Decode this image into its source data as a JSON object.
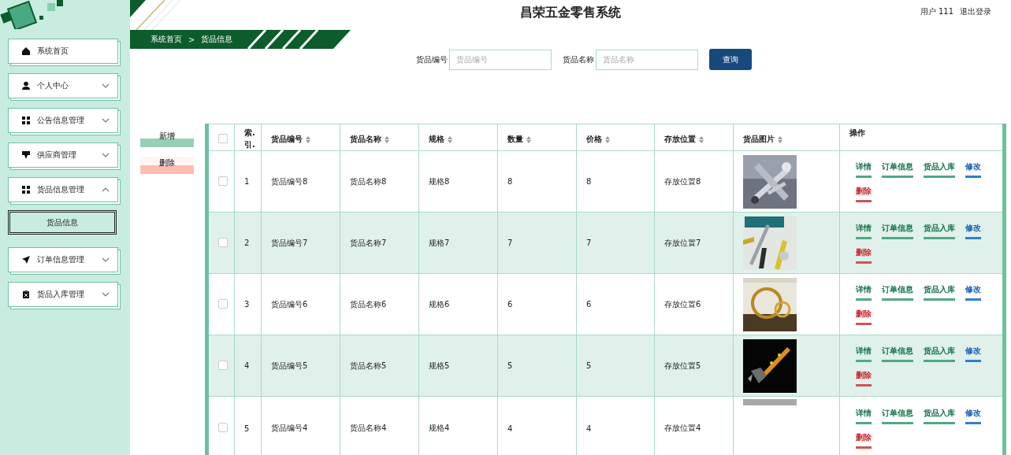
{
  "header": {
    "title": "昌荣五金零售系统",
    "user": "用户 111",
    "logout": "退出登录"
  },
  "breadcrumb": {
    "items": [
      "系统首页",
      "货品信息"
    ],
    "separator": ">"
  },
  "sidebar": {
    "items": [
      {
        "label": "系统首页"
      },
      {
        "label": "个人中心",
        "expanded": false
      },
      {
        "label": "公告信息管理",
        "expanded": false
      },
      {
        "label": "供应商管理",
        "expanded": false
      },
      {
        "label": "货品信息管理",
        "expanded": true,
        "children": [
          {
            "label": "货品信息",
            "selected": true
          }
        ]
      },
      {
        "label": "订单信息管理",
        "expanded": false
      },
      {
        "label": "货品入库管理",
        "expanded": false
      }
    ]
  },
  "search": {
    "fields": [
      {
        "label": "货品编号",
        "placeholder": "货品编号"
      },
      {
        "label": "货品名称",
        "placeholder": "货品名称"
      }
    ],
    "button": "查询"
  },
  "actions": [
    {
      "label": "新增",
      "kind": "add"
    },
    {
      "label": "删除",
      "kind": "delete"
    }
  ],
  "table": {
    "columns": [
      {
        "kind": "check",
        "checked": false
      },
      {
        "label": "索.引.",
        "sortable": false
      },
      {
        "label": "货品编号",
        "sortable": true
      },
      {
        "label": "货品名称",
        "sortable": true
      },
      {
        "label": "规格",
        "sortable": true
      },
      {
        "label": "数量",
        "sortable": true
      },
      {
        "label": "价格",
        "sortable": true
      },
      {
        "label": "存放位置",
        "sortable": true
      },
      {
        "label": "货品图片",
        "sortable": true
      },
      {
        "label": "操作",
        "sortable": false
      }
    ],
    "rows": [
      {
        "checked": false,
        "index": "1",
        "code": "货品编号8",
        "name": "货品名称8",
        "spec": "规格8",
        "qty": "8",
        "price": "8",
        "location": "存放位置8",
        "actions": [
          {
            "label": "详情",
            "kind": "view"
          },
          {
            "label": "订单信息",
            "kind": "view"
          },
          {
            "label": "货品入库",
            "kind": "view"
          },
          {
            "label": "修改",
            "kind": "edit"
          },
          {
            "label": "删除",
            "kind": "delete"
          }
        ]
      },
      {
        "checked": false,
        "index": "2",
        "code": "货品编号7",
        "name": "货品名称7",
        "spec": "规格7",
        "qty": "7",
        "price": "7",
        "location": "存放位置7",
        "actions": [
          {
            "label": "详情",
            "kind": "view"
          },
          {
            "label": "订单信息",
            "kind": "view"
          },
          {
            "label": "货品入库",
            "kind": "view"
          },
          {
            "label": "修改",
            "kind": "edit"
          },
          {
            "label": "删除",
            "kind": "delete"
          }
        ]
      },
      {
        "checked": false,
        "index": "3",
        "code": "货品编号6",
        "name": "货品名称6",
        "spec": "规格6",
        "qty": "6",
        "price": "6",
        "location": "存放位置6",
        "actions": [
          {
            "label": "详情",
            "kind": "view"
          },
          {
            "label": "订单信息",
            "kind": "view"
          },
          {
            "label": "货品入库",
            "kind": "view"
          },
          {
            "label": "修改",
            "kind": "edit"
          },
          {
            "label": "删除",
            "kind": "delete"
          }
        ]
      },
      {
        "checked": false,
        "index": "4",
        "code": "货品编号5",
        "name": "货品名称5",
        "spec": "规格5",
        "qty": "5",
        "price": "5",
        "location": "存放位置5",
        "actions": [
          {
            "label": "详情",
            "kind": "view"
          },
          {
            "label": "订单信息",
            "kind": "view"
          },
          {
            "label": "货品入库",
            "kind": "view"
          },
          {
            "label": "修改",
            "kind": "edit"
          },
          {
            "label": "删除",
            "kind": "delete"
          }
        ]
      },
      {
        "checked": false,
        "index": "5",
        "code": "货品编号4",
        "name": "货品名称4",
        "spec": "规格4",
        "qty": "4",
        "price": "4",
        "location": "存放位置4",
        "image": {
          "kind": "loading"
        },
        "actions": [
          {
            "label": "详情",
            "kind": "view"
          },
          {
            "label": "订单信息",
            "kind": "view"
          },
          {
            "label": "货品入库",
            "kind": "view"
          },
          {
            "label": "修改",
            "kind": "edit"
          },
          {
            "label": "删除",
            "kind": "delete"
          }
        ]
      }
    ]
  }
}
